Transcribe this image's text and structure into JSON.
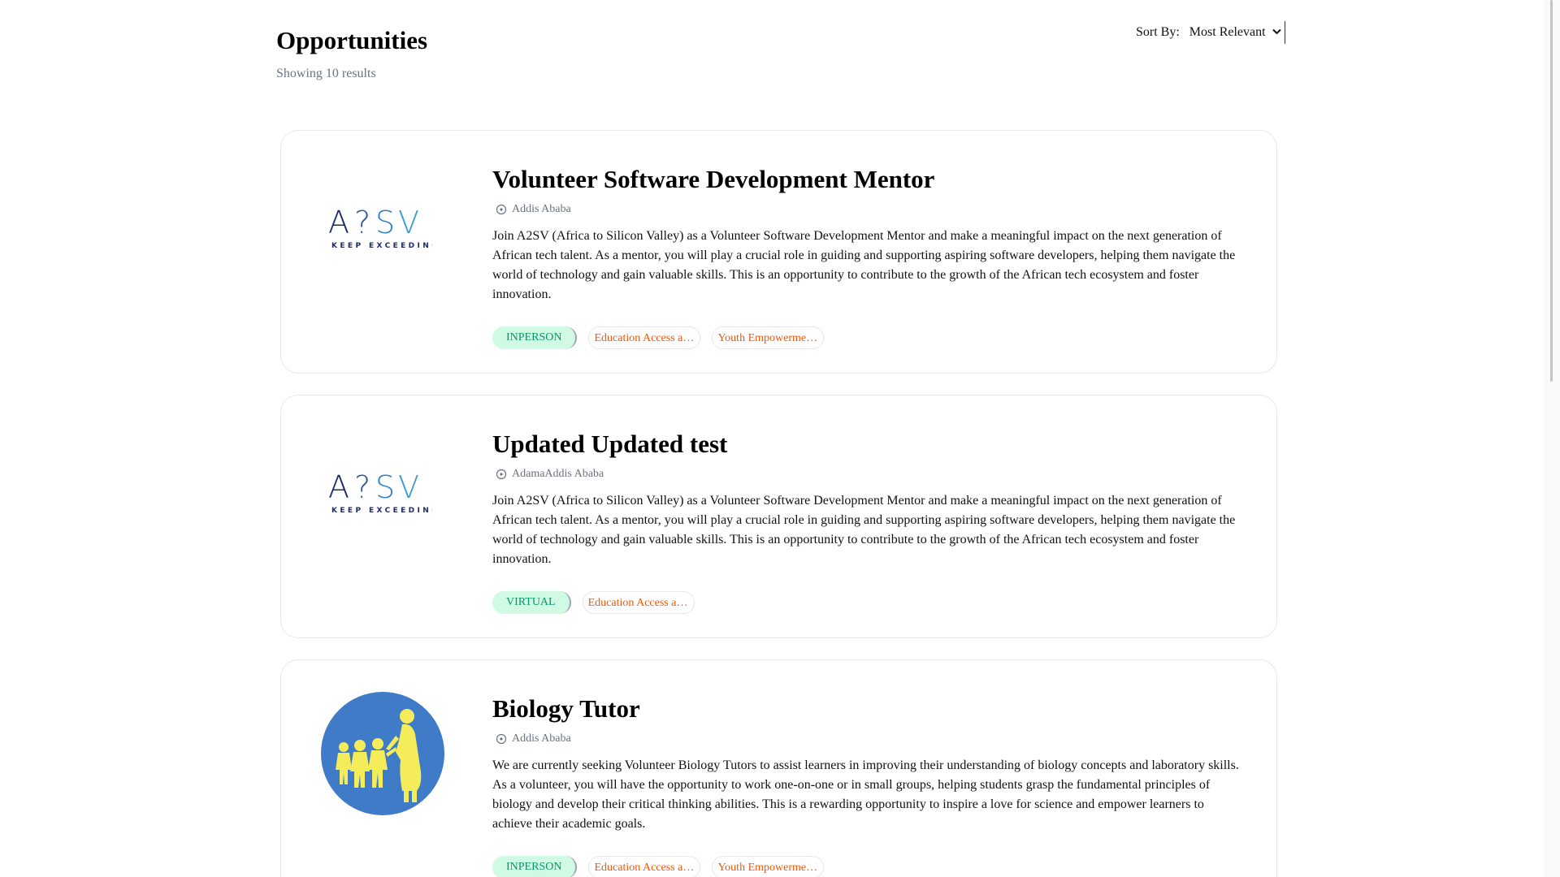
{
  "header": {
    "title": "Opportunities",
    "result_count": "Showing 10 results",
    "sort_label": "Sort By:",
    "sort_value": "Most Relevant"
  },
  "icons": {
    "location": "location-pin-icon",
    "sort": "chevron-down-icon"
  },
  "colors": {
    "type_tag_bg": "#d1fae5",
    "type_tag_text": "#059669",
    "category_tag_text": "#ea580c",
    "a2sv_dark": "#1e2b6b",
    "a2sv_light": "#3b9ad9",
    "logo_circle": "#3f7bc6",
    "logo_figures": "#f5ec5a"
  },
  "opportunities": [
    {
      "title": "Volunteer Software Development Mentor",
      "location": "Addis Ababa",
      "description": "Join A2SV (Africa to Silicon Valley) as a Volunteer Software Development Mentor and make a meaningful impact on the next generation of African tech talent. As a mentor, you will play a crucial role in guiding and supporting aspiring software developers, helping them navigate the world of technology and gain valuable skills. This is an opportunity to contribute to the growth of the African tech ecosystem and foster innovation.",
      "type": "INPERSON",
      "categories": [
        "Education Access and Quality Improvement",
        "Youth Empowerment and Development"
      ],
      "logo": {
        "text": "A2SV",
        "tagline": "KEEP EXCEEDING"
      }
    },
    {
      "title": "Updated Updated test",
      "location": "AdamaAddis Ababa",
      "description": "Join A2SV (Africa to Silicon Valley) as a Volunteer Software Development Mentor and make a meaningful impact on the next generation of African tech talent. As a mentor, you will play a crucial role in guiding and supporting aspiring software developers, helping them navigate the world of technology and gain valuable skills. This is an opportunity to contribute to the growth of the African tech ecosystem and foster innovation.",
      "type": "VIRTUAL",
      "categories": [
        "Education Access and Quality Improvement"
      ],
      "logo": {
        "text": "A2SV",
        "tagline": "KEEP EXCEEDING"
      }
    },
    {
      "title": "Biology Tutor",
      "location": "Addis Ababa",
      "description": "We are currently seeking Volunteer Biology Tutors to assist learners in improving their understanding of biology concepts and laboratory skills. As a volunteer, you will have the opportunity to work one-on-one or in small groups, helping students grasp the fundamental principles of biology and develop their critical thinking abilities. This is a rewarding opportunity to inspire a love for science and empower learners to achieve their academic goals.",
      "type": "INPERSON",
      "categories": [
        "Education Access and Quality Improvement",
        "Youth Empowerment and Development"
      ],
      "logo": {
        "icon": "teacher-children-icon"
      }
    }
  ]
}
